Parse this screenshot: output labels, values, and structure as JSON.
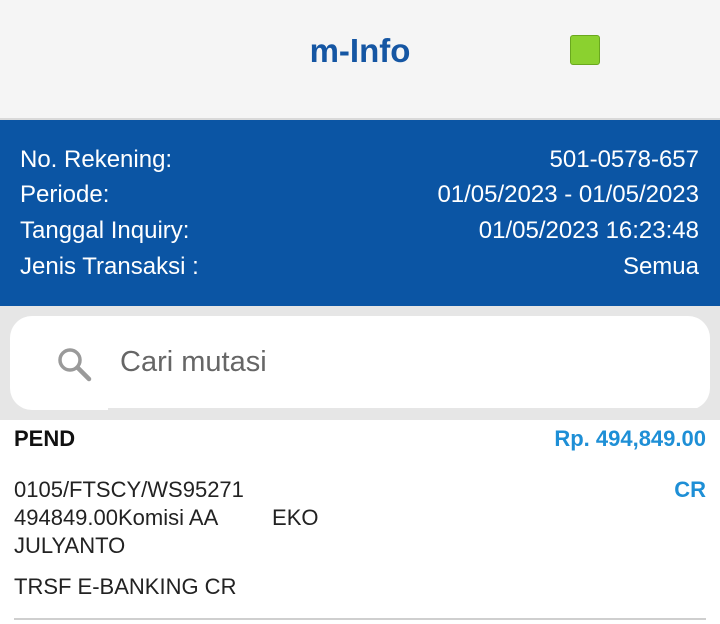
{
  "header": {
    "title": "m-Info"
  },
  "account_info": {
    "rows": [
      {
        "label": "No. Rekening:",
        "value": "501-0578-657"
      },
      {
        "label": "Periode:",
        "value": "01/05/2023 - 01/05/2023"
      },
      {
        "label": "Tanggal Inquiry:",
        "value": "01/05/2023 16:23:48"
      },
      {
        "label": "Jenis Transaksi :",
        "value": "Semua"
      }
    ]
  },
  "search": {
    "placeholder": "Cari mutasi",
    "value": "",
    "icon": "search-icon"
  },
  "transactions": [
    {
      "status": "PEND",
      "amount": "Rp. 494,849.00",
      "type": "CR",
      "description_lines": [
        "0105/FTSCY/WS95271",
        "494849.00Komisi AA         EKO",
        "JULYANTO"
      ],
      "remark": "TRSF E-BANKING CR"
    }
  ],
  "colors": {
    "title": "#1556a3",
    "info_panel": "#0b55a4",
    "amount": "#1e8fd6",
    "status_indicator": "#8bd12f"
  }
}
